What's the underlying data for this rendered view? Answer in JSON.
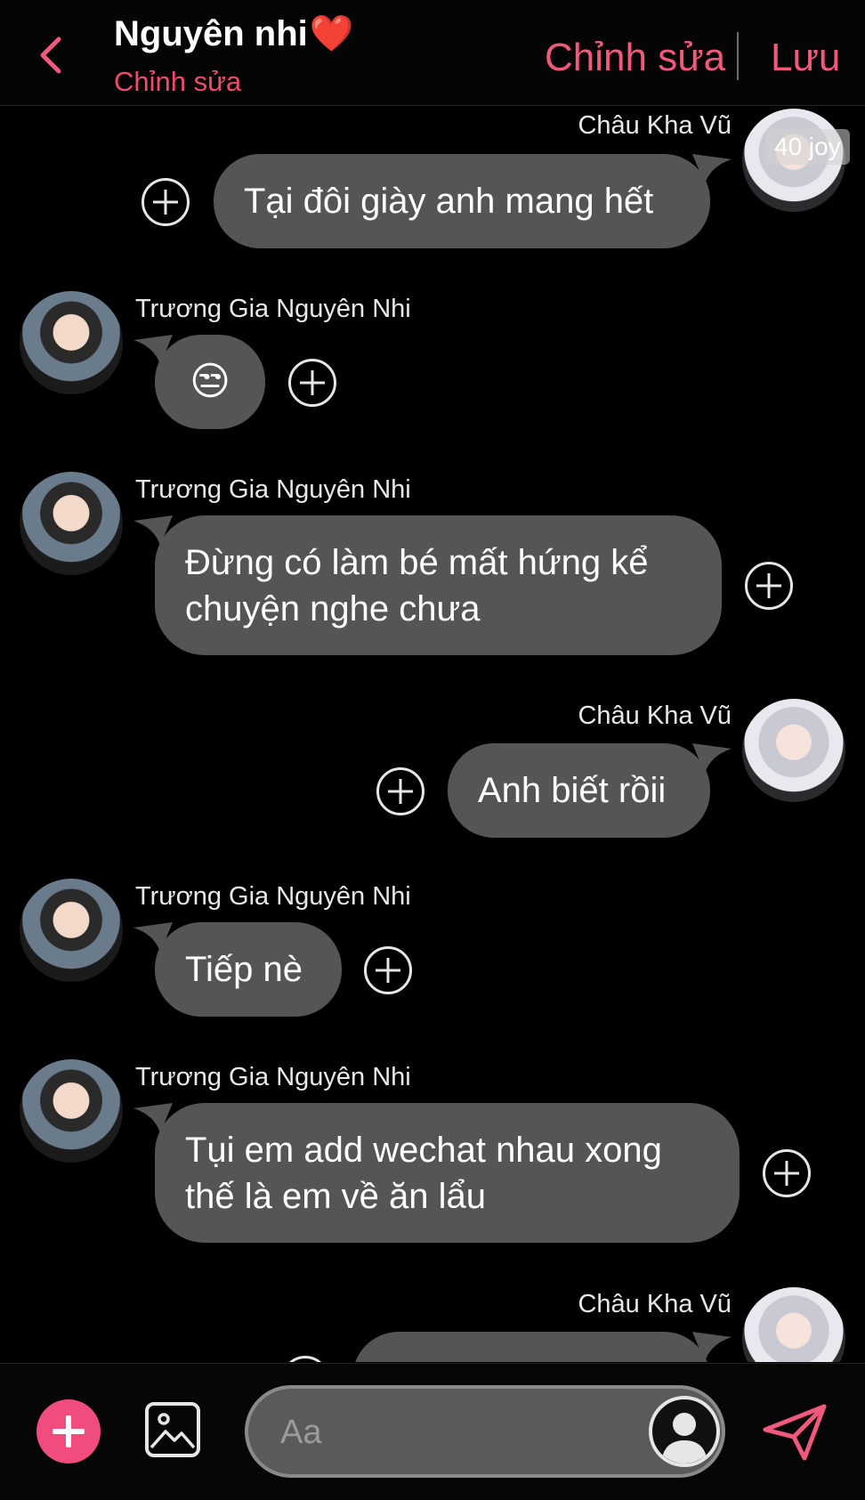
{
  "header": {
    "title": "Nguyên nhi",
    "title_emoji": "❤️",
    "subtitle": "Chỉnh sửa",
    "edit_label": "Chỉnh sửa",
    "save_label": "Lưu"
  },
  "watermark": "40 joy",
  "messages": [
    {
      "sender": "Châu Kha Vũ",
      "side": "right",
      "text": "Tại đôi giày anh mang hết"
    },
    {
      "sender": "Trương Gia Nguyên Nhi",
      "side": "left",
      "text": "😒"
    },
    {
      "sender": "Trương Gia Nguyên Nhi",
      "side": "left",
      "text": "Đừng có làm bé mất hứng kể\nchuyện nghe chưa"
    },
    {
      "sender": "Châu Kha Vũ",
      "side": "right",
      "text": "Anh biết rồii"
    },
    {
      "sender": "Trương Gia Nguyên Nhi",
      "side": "left",
      "text": "Tiếp nè"
    },
    {
      "sender": "Trương Gia Nguyên Nhi",
      "side": "left",
      "text": "Tụi em add wechat nhau xong\nthế là em về ăn lẩu"
    },
    {
      "sender": "Châu Kha Vũ",
      "side": "right",
      "text": ""
    }
  ],
  "input": {
    "placeholder": "Aa"
  },
  "icons": {
    "back": "chevron-left-icon",
    "add": "plus-icon",
    "image": "image-icon",
    "profile": "user-icon",
    "send": "send-icon"
  },
  "colors": {
    "accent": "#f0587c",
    "bubble": "#555555",
    "background": "#000000",
    "add_button": "#f04d7e"
  }
}
